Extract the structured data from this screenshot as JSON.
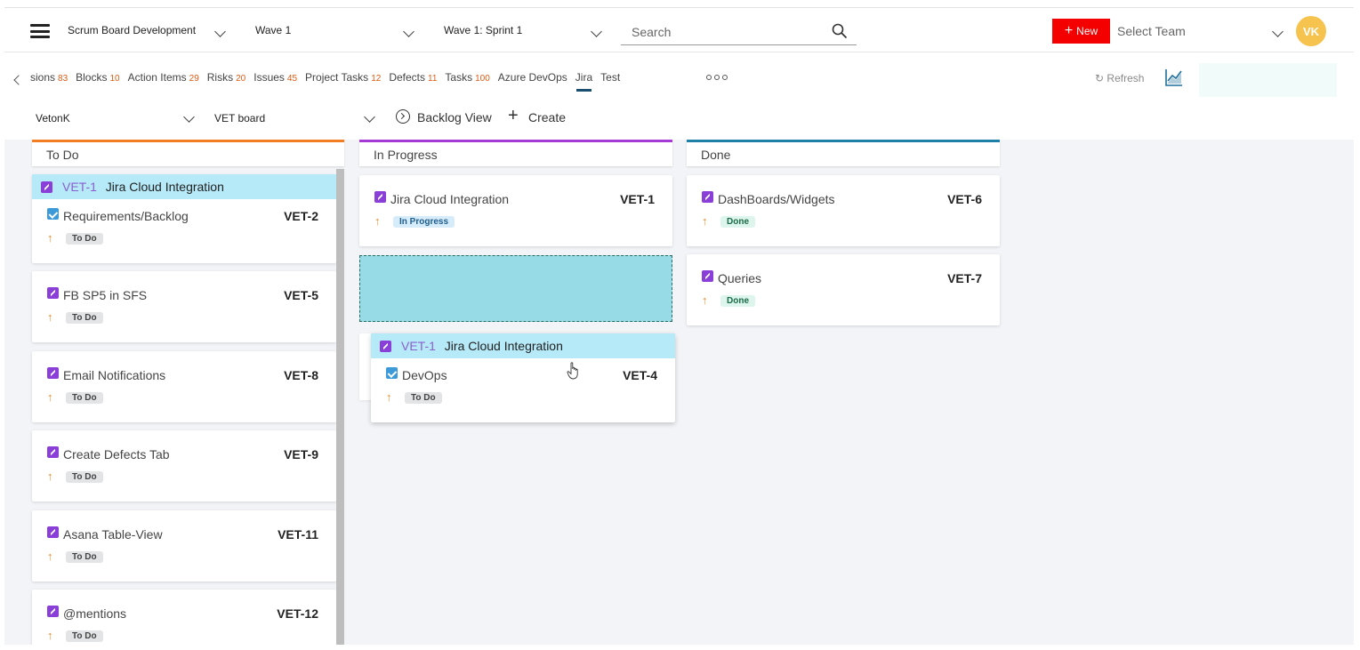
{
  "header": {
    "project_dropdown": "Scrum Board Development",
    "wave_dropdown": "Wave 1",
    "sprint_dropdown": "Wave 1: Sprint 1",
    "search_placeholder": "Search",
    "new_button": "New",
    "new_icon": "+",
    "team_select": "Select Team",
    "avatar_initials": "VK"
  },
  "tabs": [
    {
      "label": "sions",
      "count": "83"
    },
    {
      "label": "Blocks",
      "count": "10"
    },
    {
      "label": "Action Items",
      "count": "29"
    },
    {
      "label": "Risks",
      "count": "20"
    },
    {
      "label": "Issues",
      "count": "45"
    },
    {
      "label": "Project Tasks",
      "count": "12"
    },
    {
      "label": "Defects",
      "count": "11"
    },
    {
      "label": "Tasks",
      "count": "100"
    },
    {
      "label": "Azure DevOps",
      "count": ""
    },
    {
      "label": "Jira",
      "count": "",
      "active": true
    },
    {
      "label": "Test",
      "count": ""
    }
  ],
  "toolbar": {
    "refresh_label": "Refresh",
    "refresh_icon": "↻",
    "user_select": "VetonK",
    "board_select": "VET board",
    "backlog_view": "Backlog View",
    "create_label": "Create",
    "create_icon": "+"
  },
  "columns": {
    "todo": "To Do",
    "in_progress": "In Progress",
    "done": "Done"
  },
  "todo_cards": {
    "parent": {
      "key": "VET-1",
      "title": "Jira Cloud Integration"
    },
    "c1": {
      "title": "Requirements/Backlog",
      "key": "VET-2",
      "status": "To Do"
    },
    "c2": {
      "title": "FB SP5 in SFS",
      "key": "VET-5",
      "status": "To Do"
    },
    "c3": {
      "title": "Email Notifications",
      "key": "VET-8",
      "status": "To Do"
    },
    "c4": {
      "title": "Create Defects Tab",
      "key": "VET-9",
      "status": "To Do"
    },
    "c5": {
      "title": "Asana Table-View",
      "key": "VET-11",
      "status": "To Do"
    },
    "c6": {
      "title": "@mentions",
      "key": "VET-12",
      "status": "To Do"
    }
  },
  "progress_cards": {
    "c1": {
      "title": "Jira Cloud Integration",
      "key": "VET-1",
      "status": "In Progress"
    },
    "dragged": {
      "parent_key": "VET-1",
      "parent_title": "Jira Cloud Integration",
      "title": "DevOps",
      "key": "VET-4",
      "status": "To Do"
    }
  },
  "done_cards": {
    "c1": {
      "title": "DashBoards/Widgets",
      "key": "VET-6",
      "status": "Done"
    },
    "c2": {
      "title": "Queries",
      "key": "VET-7",
      "status": "Done"
    }
  },
  "priority_symbol": "↑",
  "colors": {
    "new_button": "#f40000",
    "avatar": "#f6c34f",
    "todo_accent": "#f27d22",
    "progress_accent": "#a53ad4",
    "done_accent": "#1f7fa6",
    "drop_zone": "#97dbe6",
    "parent_highlight": "#b6eaf8"
  }
}
